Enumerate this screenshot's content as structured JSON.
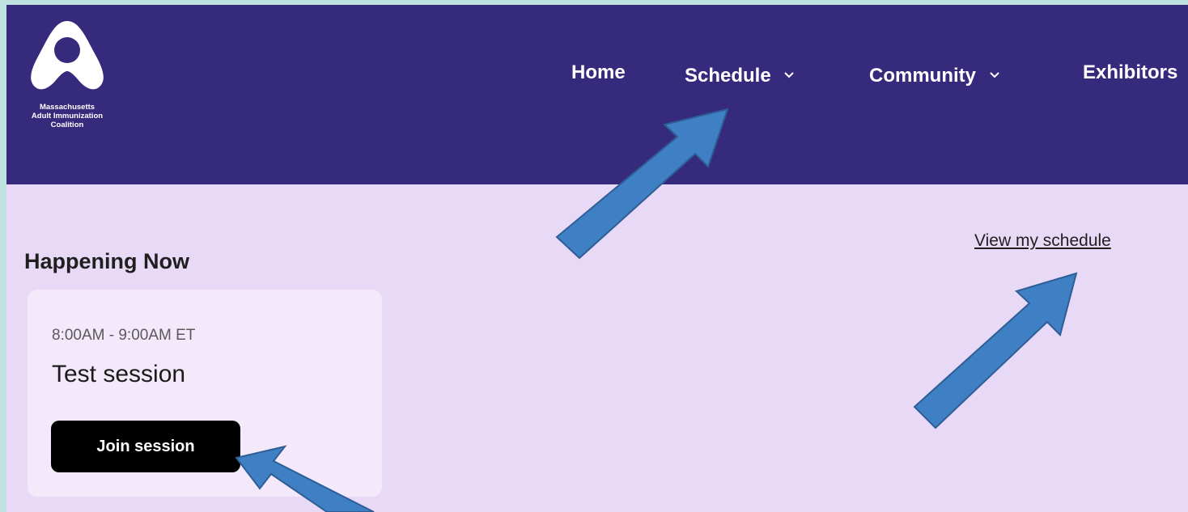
{
  "logo": {
    "name": "Massachusetts Adult Immunization Coalition",
    "lines": [
      "Massachusetts",
      "Adult Immunization",
      "Coalition"
    ]
  },
  "nav": {
    "items": [
      {
        "label": "Home",
        "has_dropdown": false
      },
      {
        "label": "Schedule",
        "has_dropdown": true
      },
      {
        "label": "Community",
        "has_dropdown": true
      },
      {
        "label": "Exhibitors",
        "has_dropdown": false
      }
    ]
  },
  "main": {
    "section_title": "Happening Now",
    "view_schedule_link": "View my schedule",
    "session": {
      "time": "8:00AM - 9:00AM ET",
      "title": "Test session",
      "join_label": "Join session"
    }
  },
  "annotations": {
    "arrow_color": "#3f7fc4",
    "arrow_border": "#2f5e96"
  },
  "colors": {
    "header_bg": "#362a7c",
    "page_bg": "#e8d9f6",
    "card_bg": "#f4e8fb",
    "button_bg": "#000000",
    "outer_bg": "#bfe3e0"
  }
}
